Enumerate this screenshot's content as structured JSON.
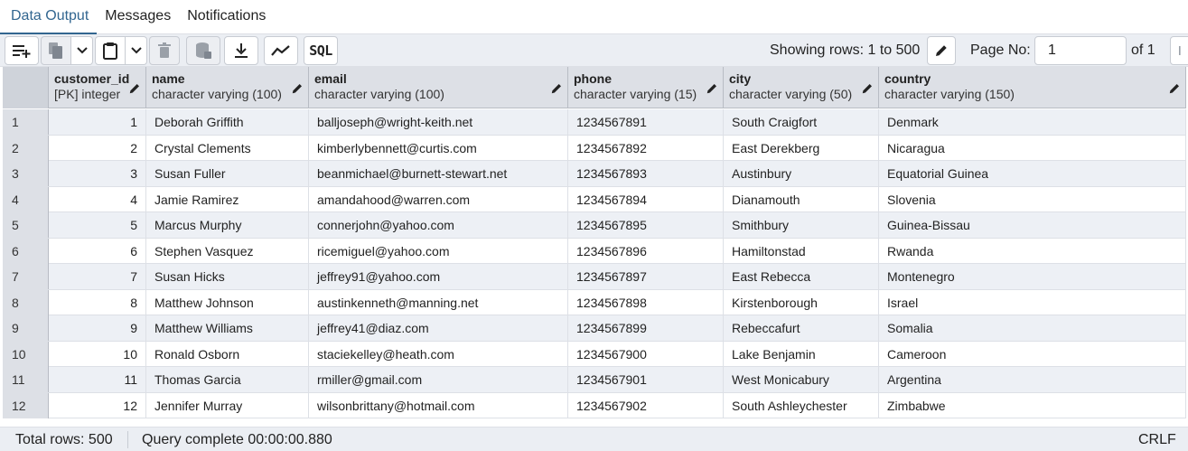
{
  "tabs": [
    {
      "label": "Data Output",
      "active": true
    },
    {
      "label": "Messages",
      "active": false
    },
    {
      "label": "Notifications",
      "active": false
    }
  ],
  "toolbar": {
    "sql_label": "SQL",
    "showing_rows": "Showing rows: 1 to 500",
    "page_no_label": "Page No:",
    "page_no_value": "1",
    "of_pages": "of 1"
  },
  "columns": [
    {
      "name": "customer_id",
      "type": "[PK] integer"
    },
    {
      "name": "name",
      "type": "character varying (100)"
    },
    {
      "name": "email",
      "type": "character varying (100)"
    },
    {
      "name": "phone",
      "type": "character varying (15)"
    },
    {
      "name": "city",
      "type": "character varying (50)"
    },
    {
      "name": "country",
      "type": "character varying (150)"
    }
  ],
  "rows": [
    {
      "n": "1",
      "id": "1",
      "name": "Deborah Griffith",
      "email": "balljoseph@wright-keith.net",
      "phone": "1234567891",
      "city": "South Craigfort",
      "country": "Denmark"
    },
    {
      "n": "2",
      "id": "2",
      "name": "Crystal Clements",
      "email": "kimberlybennett@curtis.com",
      "phone": "1234567892",
      "city": "East Derekberg",
      "country": "Nicaragua"
    },
    {
      "n": "3",
      "id": "3",
      "name": "Susan Fuller",
      "email": "beanmichael@burnett-stewart.net",
      "phone": "1234567893",
      "city": "Austinbury",
      "country": "Equatorial Guinea"
    },
    {
      "n": "4",
      "id": "4",
      "name": "Jamie Ramirez",
      "email": "amandahood@warren.com",
      "phone": "1234567894",
      "city": "Dianamouth",
      "country": "Slovenia"
    },
    {
      "n": "5",
      "id": "5",
      "name": "Marcus Murphy",
      "email": "connerjohn@yahoo.com",
      "phone": "1234567895",
      "city": "Smithbury",
      "country": "Guinea-Bissau"
    },
    {
      "n": "6",
      "id": "6",
      "name": "Stephen Vasquez",
      "email": "ricemiguel@yahoo.com",
      "phone": "1234567896",
      "city": "Hamiltonstad",
      "country": "Rwanda"
    },
    {
      "n": "7",
      "id": "7",
      "name": "Susan Hicks",
      "email": "jeffrey91@yahoo.com",
      "phone": "1234567897",
      "city": "East Rebecca",
      "country": "Montenegro"
    },
    {
      "n": "8",
      "id": "8",
      "name": "Matthew Johnson",
      "email": "austinkenneth@manning.net",
      "phone": "1234567898",
      "city": "Kirstenborough",
      "country": "Israel"
    },
    {
      "n": "9",
      "id": "9",
      "name": "Matthew Williams",
      "email": "jeffrey41@diaz.com",
      "phone": "1234567899",
      "city": "Rebeccafurt",
      "country": "Somalia"
    },
    {
      "n": "10",
      "id": "10",
      "name": "Ronald Osborn",
      "email": "staciekelley@heath.com",
      "phone": "1234567900",
      "city": "Lake Benjamin",
      "country": "Cameroon"
    },
    {
      "n": "11",
      "id": "11",
      "name": "Thomas Garcia",
      "email": "rmiller@gmail.com",
      "phone": "1234567901",
      "city": "West Monicabury",
      "country": "Argentina"
    },
    {
      "n": "12",
      "id": "12",
      "name": "Jennifer Murray",
      "email": "wilsonbrittany@hotmail.com",
      "phone": "1234567902",
      "city": "South Ashleychester",
      "country": "Zimbabwe"
    }
  ],
  "status": {
    "total_rows": "Total rows: 500",
    "query_complete": "Query complete 00:00:00.880",
    "line_ending": "CRLF"
  },
  "colors": {
    "accent": "#326690",
    "header_bg": "#dde0e6",
    "row_alt_bg": "#edf0f5",
    "toolbar_bg": "#ebeef3"
  }
}
